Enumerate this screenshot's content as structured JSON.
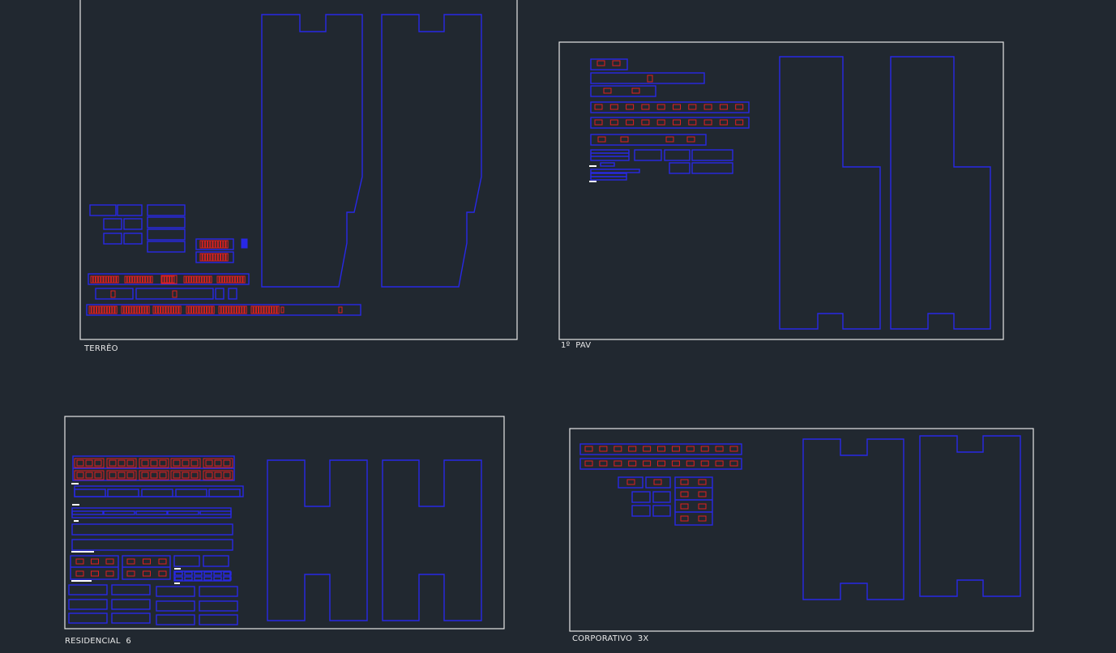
{
  "drawing": {
    "background": "#212830",
    "colors": {
      "frame": "#e6e6e6",
      "outline": "#2828e6",
      "block": "#e02020",
      "small_text": "#ffffff"
    },
    "sheets": [
      {
        "id": "terreo",
        "label": "TERRÊO"
      },
      {
        "id": "pav1",
        "label": "1º  PAV"
      },
      {
        "id": "residencial",
        "label": "RESIDENCIAL  6"
      },
      {
        "id": "corporativo",
        "label": "CORPORATIVO  3X"
      }
    ]
  }
}
